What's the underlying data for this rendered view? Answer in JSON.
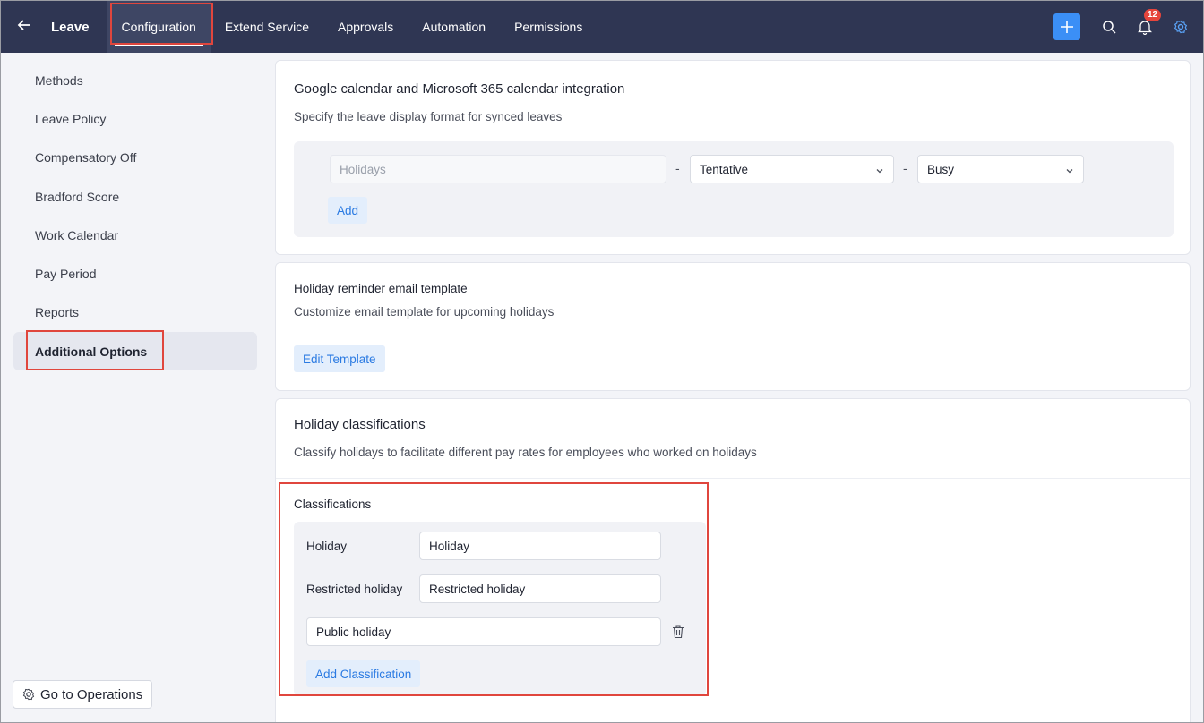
{
  "topbar": {
    "app_title": "Leave",
    "nav": [
      "Configuration",
      "Extend Service",
      "Approvals",
      "Automation",
      "Permissions"
    ],
    "notification_count": "12",
    "colors": {
      "background": "#2f3653",
      "accent": "#3b8ff6",
      "badge": "#e6453c"
    }
  },
  "sidebar": {
    "items": [
      {
        "label": "Methods"
      },
      {
        "label": "Leave Policy"
      },
      {
        "label": "Compensatory Off"
      },
      {
        "label": "Bradford Score"
      },
      {
        "label": "Work Calendar"
      },
      {
        "label": "Pay Period"
      },
      {
        "label": "Reports"
      },
      {
        "label": "Additional Options"
      }
    ],
    "ops_button": "Go to Operations"
  },
  "calendar_card": {
    "title": "Google calendar and Microsoft 365 calendar integration",
    "description": "Specify the leave display format for synced leaves",
    "row": {
      "input_value": "Holidays",
      "separator": "-",
      "status_select": "Tentative",
      "availability_select": "Busy"
    },
    "add_label": "Add"
  },
  "reminder_card": {
    "title": "Holiday reminder email template",
    "description": "Customize email template for upcoming holidays",
    "edit_label": "Edit Template"
  },
  "classification_card": {
    "title": "Holiday classifications",
    "description": "Classify holidays to facilitate different pay rates for employees who worked on holidays",
    "section_label": "Classifications",
    "rows": [
      {
        "label": "Holiday",
        "value": "Holiday"
      },
      {
        "label": "Restricted holiday",
        "value": "Restricted holiday"
      },
      {
        "label": "",
        "value": "Public holiday"
      }
    ],
    "add_label": "Add Classification"
  },
  "icons": [
    "back-arrow-icon",
    "plus-icon",
    "search-icon",
    "bell-icon",
    "settings-icon",
    "chevron-down-icon",
    "trash-icon",
    "gear-icon"
  ]
}
